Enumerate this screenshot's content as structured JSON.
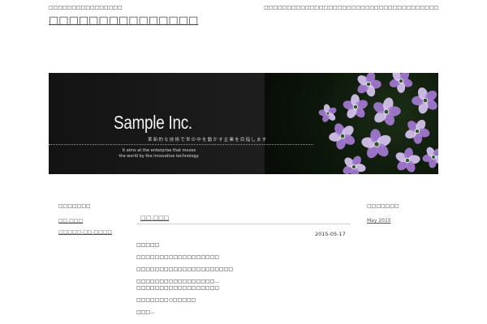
{
  "header": {
    "tagline": "□□□□□□□□□□□□□□□□",
    "site_title": "□□□□□□□□□□□□□□□",
    "top_nav_text": "□□□□□□□□□□□□□□□□□□□□□□□□□□□□□□□□□□□□□□□□□□□□□□□□□□□□□□□□□□□□□□□□□□□□□□"
  },
  "banner": {
    "company": "Sample Inc.",
    "tagline_jp": "革新的な技術で世の中を動かす企業を目指します",
    "tagline_en": "It aims at the enterprise that moves the world by the innovative technology.",
    "colors": {
      "flower_purple": "#a57ad3",
      "flower_light": "#d8c4f0",
      "flower_center": "#2d5a2a"
    }
  },
  "sidebar_left": {
    "title": "□□□□□□□",
    "links": [
      "□□.□□□",
      "□□□□□.□□.□□□□"
    ]
  },
  "sidebar_right": {
    "title": "□□□□□□□",
    "archive_link": "May 2015"
  },
  "post": {
    "title": "□□.□□□",
    "date": "2015-05-17",
    "paragraphs": [
      "□□□□□",
      "□□□□□□□□□□□□□□□□□□",
      "□□□□□□□□□□□□□□□□□□□□□",
      "□□□□□□□□□□□□□□□□□...",
      "□□□□□□□□□□□□□□□□□□",
      "□□□□□□□○□□□□□",
      "□□□..."
    ]
  }
}
